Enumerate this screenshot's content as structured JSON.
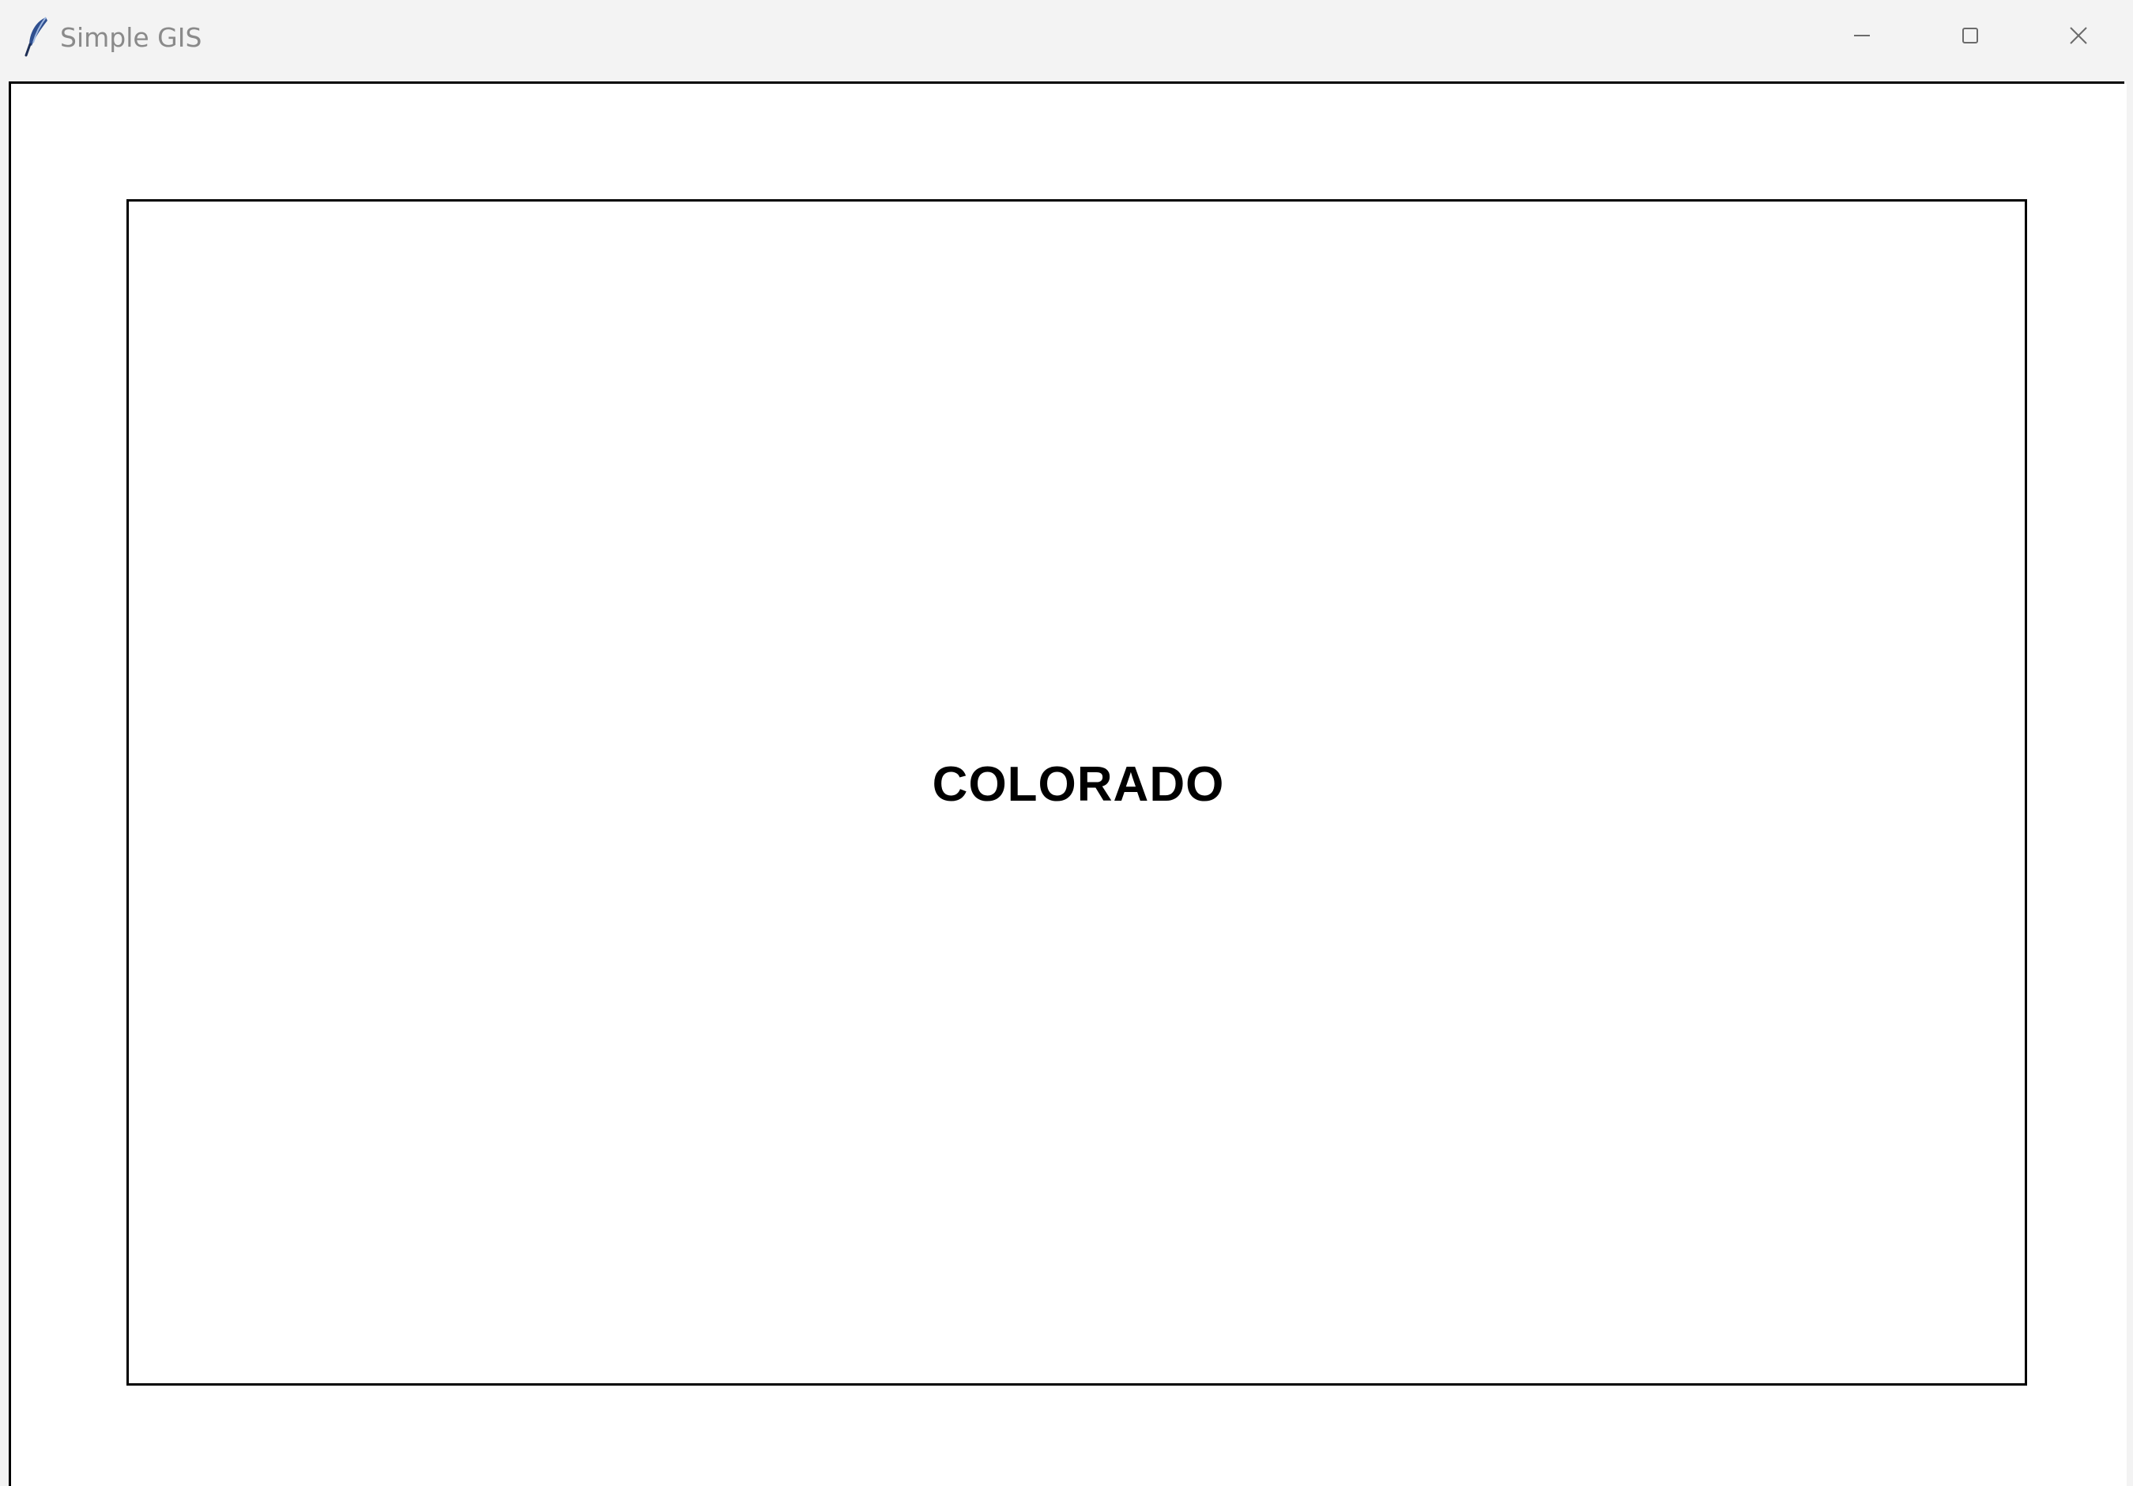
{
  "window": {
    "title": "Simple GIS",
    "icon": "feather-icon",
    "controls": {
      "minimize_icon": "minimize-icon",
      "maximize_icon": "maximize-icon",
      "close_icon": "close-icon"
    }
  },
  "map": {
    "state_label": "COLORADO",
    "colors": {
      "background": "#ffffff",
      "frame": "#000000",
      "label": "#000000"
    }
  }
}
